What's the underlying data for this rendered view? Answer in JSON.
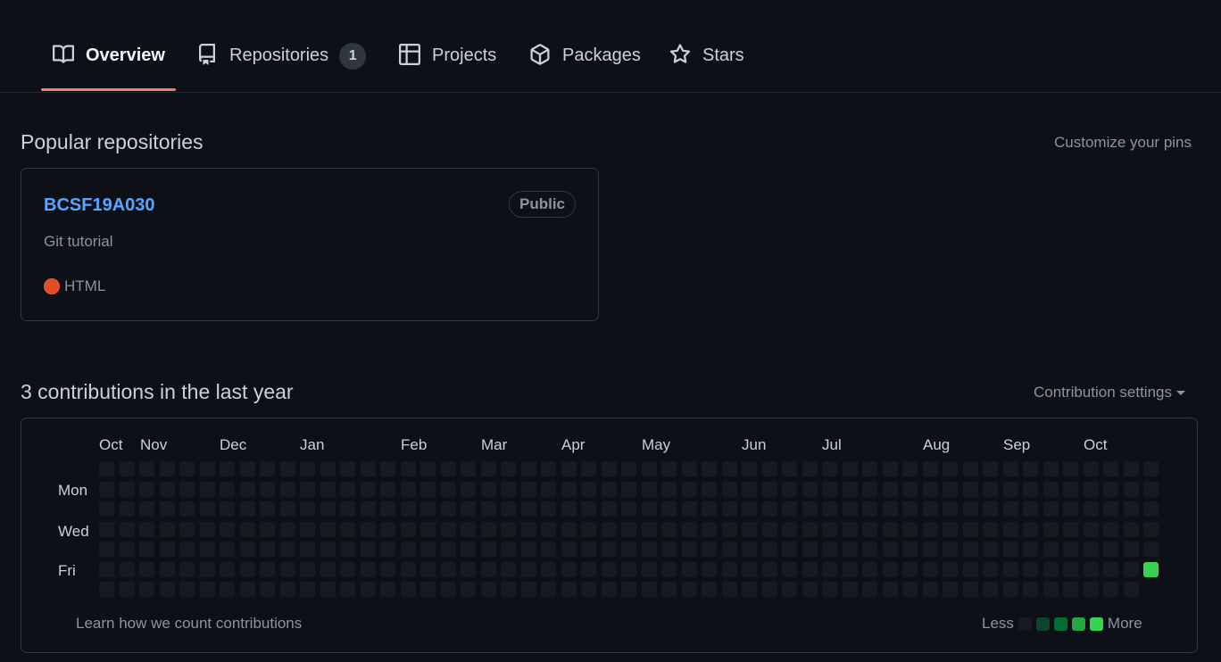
{
  "tabs": [
    {
      "label": "Overview",
      "icon": "book-icon",
      "selected": true
    },
    {
      "label": "Repositories",
      "icon": "repo-icon",
      "count": "1"
    },
    {
      "label": "Projects",
      "icon": "table-icon"
    },
    {
      "label": "Packages",
      "icon": "package-icon"
    },
    {
      "label": "Stars",
      "icon": "star-icon"
    }
  ],
  "pinned": {
    "title": "Popular repositories",
    "customize_link": "Customize your pins",
    "repo": {
      "name": "BCSF19A030",
      "visibility": "Public",
      "description": "Git tutorial",
      "language": "HTML",
      "language_color": "#e34c26"
    }
  },
  "contributions": {
    "title": "3 contributions in the last year",
    "settings_label": "Contribution settings",
    "months": [
      "Oct",
      "Nov",
      "Dec",
      "Jan",
      "Feb",
      "Mar",
      "Apr",
      "May",
      "Jun",
      "Jul",
      "Aug",
      "Sep",
      "Oct"
    ],
    "weekdays": [
      "Mon",
      "Wed",
      "Fri"
    ],
    "weeks": 53,
    "last_week_days": 6,
    "highlighted_cell": {
      "week": 53,
      "day": "Fri",
      "level": 4
    },
    "footer_link": "Learn how we count contributions",
    "legend_less": "Less",
    "legend_more": "More",
    "colors": {
      "level0": "#161b22",
      "level1": "#0e4429",
      "level2": "#006d32",
      "level3": "#26a641",
      "level4": "#39d353"
    }
  }
}
